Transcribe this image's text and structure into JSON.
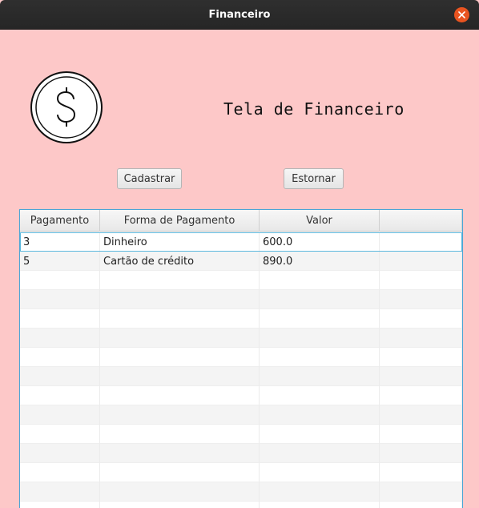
{
  "window": {
    "title": "Financeiro"
  },
  "header": {
    "heading": "Tela de Financeiro",
    "logo_icon": "dollar-circle-icon"
  },
  "toolbar": {
    "cadastrar_label": "Cadastrar",
    "estornar_label": "Estornar"
  },
  "table": {
    "columns": [
      "Pagamento",
      "Forma de Pagamento",
      "Valor",
      ""
    ],
    "rows": [
      {
        "pagamento": "3",
        "forma": "Dinheiro",
        "valor": "600.0",
        "extra": ""
      },
      {
        "pagamento": "5",
        "forma": "Cartão de crédito",
        "valor": "890.0",
        "extra": ""
      }
    ]
  },
  "colors": {
    "background": "#fdc8c8",
    "titlebar": "#2b2b2b",
    "close": "#e95420",
    "table_border": "#4aa6d6"
  }
}
